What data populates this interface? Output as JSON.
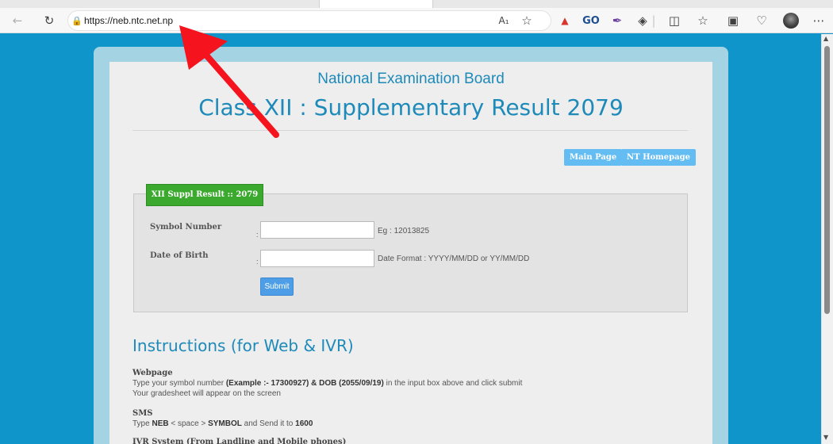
{
  "browser": {
    "url": "https://neb.ntc.net.np",
    "back_icon": "arrow-left",
    "refresh_icon": "refresh",
    "lock_icon": "lock",
    "read_aloud_icon": "read-aloud",
    "favorite_icon": "star",
    "ext1_icon": "extension-red",
    "ext2_label": "GO",
    "ext3_icon": "extension-purple",
    "extensions_icon": "puzzle",
    "split_icon": "split-screen",
    "favorites_icon": "favorites-list",
    "collections_icon": "collections",
    "health_icon": "browser-essentials",
    "menu_icon": "more"
  },
  "page": {
    "heading_small": "National Examination Board",
    "heading_title": "Class XII : Supplementary Result 2079",
    "buttons": {
      "main_page": "Main Page",
      "nt_homepage": "NT Homepage"
    },
    "form": {
      "legend": "XII Suppl Result :: 2079",
      "symbol_label": "Symbol Number",
      "symbol_value": "",
      "symbol_hint": "Eg : 12013825",
      "dob_label": "Date of Birth",
      "dob_value": "",
      "dob_hint": "Date Format : YYYY/MM/DD or YY/MM/DD",
      "colon": ":",
      "submit": "Submit"
    },
    "instructions": {
      "heading": "Instructions (for Web & IVR)",
      "webpage": {
        "title": "Webpage",
        "line1_a": "Type your symbol number ",
        "line1_b": "(Example :- 17300927) & DOB (2055/09/19)",
        "line1_c": " in the input box above and click submit",
        "line2": "Your gradesheet will appear on the screen"
      },
      "sms": {
        "title": "SMS",
        "line_a": "Type ",
        "line_b": "NEB",
        "line_c": " < space > ",
        "line_d": "SYMBOL",
        "line_e": " and Send it to ",
        "line_f": "1600"
      },
      "ivr_title": "IVR System (From Landline and Mobile phones)"
    }
  },
  "colors": {
    "background": "#0f95c9",
    "heading": "#1d8ab9",
    "legend_green": "#3aa92e",
    "button_blue": "#64bdf2",
    "arrow_red": "#f5141e"
  }
}
